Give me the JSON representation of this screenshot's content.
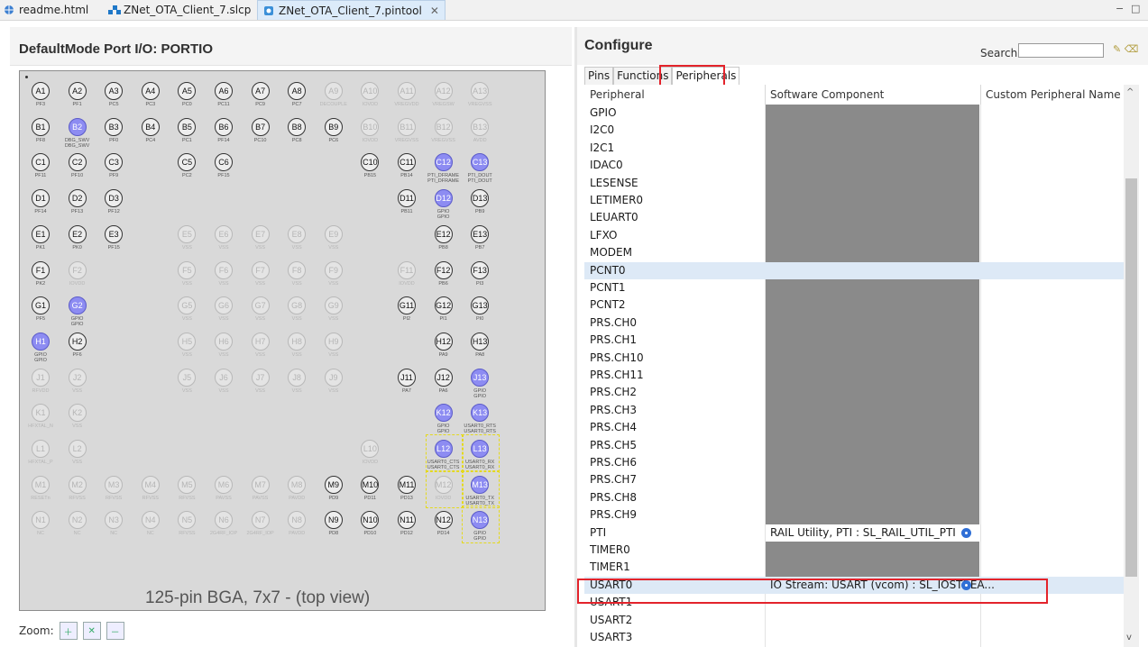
{
  "tabs": [
    {
      "label": "readme.html",
      "icon": "globe-icon",
      "active": false
    },
    {
      "label": "ZNet_OTA_Client_7.slcp",
      "icon": "project-icon",
      "active": false
    },
    {
      "label": "ZNet_OTA_Client_7.pintool",
      "icon": "pintool-icon",
      "active": true
    }
  ],
  "window_controls": {
    "minimize": "−",
    "maximize": "□"
  },
  "left": {
    "title": "DefaultMode Port I/O: PORTIO",
    "caption": "125-pin BGA, 7x7 - (top view)",
    "zoom_label": "Zoom:",
    "zoom_buttons": [
      "zoom-in-icon",
      "zoom-fit-icon",
      "zoom-out-icon"
    ]
  },
  "chip": {
    "rows": [
      "A",
      "B",
      "C",
      "D",
      "E",
      "F",
      "G",
      "H",
      "J",
      "K",
      "L",
      "M",
      "N"
    ],
    "pins": [
      [
        "A1",
        "n",
        "PF3"
      ],
      [
        "A2",
        "n",
        "PF1"
      ],
      [
        "A3",
        "n",
        "PC5"
      ],
      [
        "A4",
        "n",
        "PC3"
      ],
      [
        "A5",
        "n",
        "PC0"
      ],
      [
        "A6",
        "n",
        "PC11"
      ],
      [
        "A7",
        "n",
        "PC9"
      ],
      [
        "A8",
        "n",
        "PC7"
      ],
      [
        "A9",
        "d",
        "DECOUPLE"
      ],
      [
        "A10",
        "d",
        "IOVDD"
      ],
      [
        "A11",
        "d",
        "VREGVDD"
      ],
      [
        "A12",
        "d",
        "VREGSW"
      ],
      [
        "A13",
        "d",
        "VREGVSS"
      ],
      [
        "B1",
        "n",
        "PF8"
      ],
      [
        "B2",
        "u",
        "DBG_SWV\nDBG_SWV"
      ],
      [
        "B3",
        "n",
        "PF0"
      ],
      [
        "B4",
        "n",
        "PC4"
      ],
      [
        "B5",
        "n",
        "PC1"
      ],
      [
        "B6",
        "n",
        "PF14"
      ],
      [
        "B7",
        "n",
        "PC10"
      ],
      [
        "B8",
        "n",
        "PC8"
      ],
      [
        "B9",
        "n",
        "PC6"
      ],
      [
        "B10",
        "d",
        "IOVDD"
      ],
      [
        "B11",
        "d",
        "VREGVSS"
      ],
      [
        "B12",
        "d",
        "VREGVSS"
      ],
      [
        "B13",
        "d",
        "AVDD"
      ],
      [
        "C1",
        "n",
        "PF11"
      ],
      [
        "C2",
        "n",
        "PF10"
      ],
      [
        "C3",
        "n",
        "PF9"
      ],
      [
        "",
        "x",
        ""
      ],
      [
        "C5",
        "n",
        "PC2"
      ],
      [
        "C6",
        "n",
        "PF15"
      ],
      [
        "",
        "x",
        ""
      ],
      [
        "",
        "x",
        ""
      ],
      [
        "",
        "x",
        ""
      ],
      [
        "C10",
        "n",
        "PB15"
      ],
      [
        "C11",
        "n",
        "PB14"
      ],
      [
        "C12",
        "u",
        "PTI_DFRAME\nPTI_DFRAME"
      ],
      [
        "C13",
        "u",
        "PTI_DOUT\nPTI_DOUT"
      ],
      [
        "D1",
        "n",
        "PF14"
      ],
      [
        "D2",
        "n",
        "PF13"
      ],
      [
        "D3",
        "n",
        "PF12"
      ],
      [
        "",
        "x",
        ""
      ],
      [
        "",
        "x",
        ""
      ],
      [
        "",
        "x",
        ""
      ],
      [
        "",
        "x",
        ""
      ],
      [
        "",
        "x",
        ""
      ],
      [
        "",
        "x",
        ""
      ],
      [
        "",
        "x",
        ""
      ],
      [
        "D11",
        "n",
        "PB11"
      ],
      [
        "D12",
        "g",
        "GPIO\nGPIO"
      ],
      [
        "D13",
        "n",
        "PB9"
      ],
      [
        "E1",
        "n",
        "PK1"
      ],
      [
        "E2",
        "n",
        "PK0"
      ],
      [
        "E3",
        "n",
        "PF15"
      ],
      [
        "",
        "x",
        ""
      ],
      [
        "E5",
        "d",
        "VSS"
      ],
      [
        "E6",
        "d",
        "VSS"
      ],
      [
        "E7",
        "d",
        "VSS"
      ],
      [
        "E8",
        "d",
        "VSS"
      ],
      [
        "E9",
        "d",
        "VSS"
      ],
      [
        "",
        "x",
        ""
      ],
      [
        "",
        "x",
        ""
      ],
      [
        "E12",
        "n",
        "PB8"
      ],
      [
        "E13",
        "n",
        "PB7"
      ],
      [
        "F1",
        "n",
        "PK2"
      ],
      [
        "F2",
        "d",
        "IOVDD"
      ],
      [
        "",
        "x",
        ""
      ],
      [
        "",
        "x",
        ""
      ],
      [
        "F5",
        "d",
        "VSS"
      ],
      [
        "F6",
        "d",
        "VSS"
      ],
      [
        "F7",
        "d",
        "VSS"
      ],
      [
        "F8",
        "d",
        "VSS"
      ],
      [
        "F9",
        "d",
        "VSS"
      ],
      [
        "",
        "x",
        ""
      ],
      [
        "F11",
        "d",
        "IOVDD"
      ],
      [
        "F12",
        "n",
        "PB6"
      ],
      [
        "F13",
        "n",
        "PI3"
      ],
      [
        "G1",
        "n",
        "PF5"
      ],
      [
        "G2",
        "g",
        "GPIO\nGPIO"
      ],
      [
        "",
        "x",
        ""
      ],
      [
        "",
        "x",
        ""
      ],
      [
        "G5",
        "d",
        "VSS"
      ],
      [
        "G6",
        "d",
        "VSS"
      ],
      [
        "G7",
        "d",
        "VSS"
      ],
      [
        "G8",
        "d",
        "VSS"
      ],
      [
        "G9",
        "d",
        "VSS"
      ],
      [
        "",
        "x",
        ""
      ],
      [
        "G11",
        "n",
        "PI2"
      ],
      [
        "G12",
        "n",
        "PI1"
      ],
      [
        "G13",
        "n",
        "PI0"
      ],
      [
        "H1",
        "g",
        "GPIO\nGPIO"
      ],
      [
        "H2",
        "n",
        "PF6"
      ],
      [
        "",
        "x",
        ""
      ],
      [
        "",
        "x",
        ""
      ],
      [
        "H5",
        "d",
        "VSS"
      ],
      [
        "H6",
        "d",
        "VSS"
      ],
      [
        "H7",
        "d",
        "VSS"
      ],
      [
        "H8",
        "d",
        "VSS"
      ],
      [
        "H9",
        "d",
        "VSS"
      ],
      [
        "",
        "x",
        ""
      ],
      [
        "",
        "x",
        ""
      ],
      [
        "H12",
        "n",
        "PA9"
      ],
      [
        "H13",
        "n",
        "PA8"
      ],
      [
        "J1",
        "d",
        "RFVDD"
      ],
      [
        "J2",
        "d",
        "VSS"
      ],
      [
        "",
        "x",
        ""
      ],
      [
        "",
        "x",
        ""
      ],
      [
        "J5",
        "d",
        "VSS"
      ],
      [
        "J6",
        "d",
        "VSS"
      ],
      [
        "J7",
        "d",
        "VSS"
      ],
      [
        "J8",
        "d",
        "VSS"
      ],
      [
        "J9",
        "d",
        "VSS"
      ],
      [
        "",
        "x",
        ""
      ],
      [
        "J11",
        "n",
        "PA7"
      ],
      [
        "J12",
        "n",
        "PA6"
      ],
      [
        "J13",
        "g",
        "GPIO\nGPIO"
      ],
      [
        "K1",
        "d",
        "HFXTAL_N"
      ],
      [
        "K2",
        "d",
        "VSS"
      ],
      [
        "",
        "x",
        ""
      ],
      [
        "",
        "x",
        ""
      ],
      [
        "",
        "x",
        ""
      ],
      [
        "",
        "x",
        ""
      ],
      [
        "",
        "x",
        ""
      ],
      [
        "",
        "x",
        ""
      ],
      [
        "",
        "x",
        ""
      ],
      [
        "",
        "x",
        ""
      ],
      [
        "",
        "x",
        ""
      ],
      [
        "K12",
        "g",
        "GPIO\nGPIO"
      ],
      [
        "K13",
        "u",
        "USART0_RTS\nUSART0_RTS"
      ],
      [
        "L1",
        "d",
        "HFXTAL_P"
      ],
      [
        "L2",
        "d",
        "VSS"
      ],
      [
        "",
        "x",
        ""
      ],
      [
        "",
        "x",
        ""
      ],
      [
        "",
        "x",
        ""
      ],
      [
        "",
        "x",
        ""
      ],
      [
        "",
        "x",
        ""
      ],
      [
        "",
        "x",
        ""
      ],
      [
        "",
        "x",
        ""
      ],
      [
        "L10",
        "d",
        "IOVDD"
      ],
      [
        "",
        "x",
        ""
      ],
      [
        "L12",
        "u",
        "USART0_CTS\nUSART0_CTS"
      ],
      [
        "L13",
        "u",
        "USART0_RX\nUSART0_RX"
      ],
      [
        "M1",
        "d",
        "RESETn"
      ],
      [
        "M2",
        "d",
        "RFVSS"
      ],
      [
        "M3",
        "d",
        "RFVSS"
      ],
      [
        "M4",
        "d",
        "RFVSS"
      ],
      [
        "M5",
        "d",
        "RFVSS"
      ],
      [
        "M6",
        "d",
        "PAVSS"
      ],
      [
        "M7",
        "d",
        "PAVSS"
      ],
      [
        "M8",
        "d",
        "PAVDD"
      ],
      [
        "M9",
        "n",
        "PD9"
      ],
      [
        "M10",
        "n",
        "PD11"
      ],
      [
        "M11",
        "n",
        "PD13"
      ],
      [
        "M12",
        "d",
        "IOVDD"
      ],
      [
        "M13",
        "u",
        "USART0_TX\nUSART0_TX"
      ],
      [
        "N1",
        "d",
        "NC"
      ],
      [
        "N2",
        "d",
        "NC"
      ],
      [
        "N3",
        "d",
        "NC"
      ],
      [
        "N4",
        "d",
        "NC"
      ],
      [
        "N5",
        "d",
        "RFVSS"
      ],
      [
        "N6",
        "d",
        "2G4RF_IOP"
      ],
      [
        "N7",
        "d",
        "2G4RF_IOP"
      ],
      [
        "N8",
        "d",
        "PAVDD"
      ],
      [
        "N9",
        "n",
        "PD8"
      ],
      [
        "N10",
        "n",
        "PD10"
      ],
      [
        "N11",
        "n",
        "PD12"
      ],
      [
        "N12",
        "n",
        "PD14"
      ],
      [
        "N13",
        "g",
        "GPIO\nGPIO"
      ]
    ]
  },
  "right": {
    "title": "Configure",
    "search_label": "Search:",
    "search_value": "",
    "subtabs": [
      "Pins",
      "Functions",
      "Peripherals"
    ],
    "active_subtab": "Peripherals",
    "columns": [
      "Peripheral",
      "Software Component",
      "Custom Peripheral Name"
    ],
    "rows": [
      {
        "name": "GPIO",
        "comp": "",
        "state": "gray"
      },
      {
        "name": "I2C0",
        "comp": "",
        "state": "gray"
      },
      {
        "name": "I2C1",
        "comp": "",
        "state": "gray"
      },
      {
        "name": "IDAC0",
        "comp": "",
        "state": "gray"
      },
      {
        "name": "LESENSE",
        "comp": "",
        "state": "gray"
      },
      {
        "name": "LETIMER0",
        "comp": "",
        "state": "gray"
      },
      {
        "name": "LEUART0",
        "comp": "",
        "state": "gray"
      },
      {
        "name": "LFXO",
        "comp": "",
        "state": "gray"
      },
      {
        "name": "MODEM",
        "comp": "",
        "state": "gray"
      },
      {
        "name": "PCNT0",
        "comp": "",
        "state": "sel"
      },
      {
        "name": "PCNT1",
        "comp": "",
        "state": "gray"
      },
      {
        "name": "PCNT2",
        "comp": "",
        "state": "gray"
      },
      {
        "name": "PRS.CH0",
        "comp": "",
        "state": "gray"
      },
      {
        "name": "PRS.CH1",
        "comp": "",
        "state": "gray"
      },
      {
        "name": "PRS.CH10",
        "comp": "",
        "state": "gray"
      },
      {
        "name": "PRS.CH11",
        "comp": "",
        "state": "gray"
      },
      {
        "name": "PRS.CH2",
        "comp": "",
        "state": "gray"
      },
      {
        "name": "PRS.CH3",
        "comp": "",
        "state": "gray"
      },
      {
        "name": "PRS.CH4",
        "comp": "",
        "state": "gray"
      },
      {
        "name": "PRS.CH5",
        "comp": "",
        "state": "gray"
      },
      {
        "name": "PRS.CH6",
        "comp": "",
        "state": "gray"
      },
      {
        "name": "PRS.CH7",
        "comp": "",
        "state": "gray"
      },
      {
        "name": "PRS.CH8",
        "comp": "",
        "state": "gray"
      },
      {
        "name": "PRS.CH9",
        "comp": "",
        "state": "gray"
      },
      {
        "name": "PTI",
        "comp": "RAIL Utility, PTI : SL_RAIL_UTIL_PTI",
        "state": "cfg"
      },
      {
        "name": "TIMER0",
        "comp": "",
        "state": "gray"
      },
      {
        "name": "TIMER1",
        "comp": "",
        "state": "gray"
      },
      {
        "name": "USART0",
        "comp": "IO Stream: USART (vcom) : SL_IOSTREA...",
        "state": "selcfg"
      },
      {
        "name": "USART1",
        "comp": "",
        "state": "plain"
      },
      {
        "name": "USART2",
        "comp": "",
        "state": "plain"
      },
      {
        "name": "USART3",
        "comp": "",
        "state": "plain"
      }
    ]
  },
  "colors": {
    "used_pin": "#8d8cf2",
    "highlight": "#e3232b",
    "selection": "#dde9f6",
    "unavailable": "#8a8a8a"
  }
}
